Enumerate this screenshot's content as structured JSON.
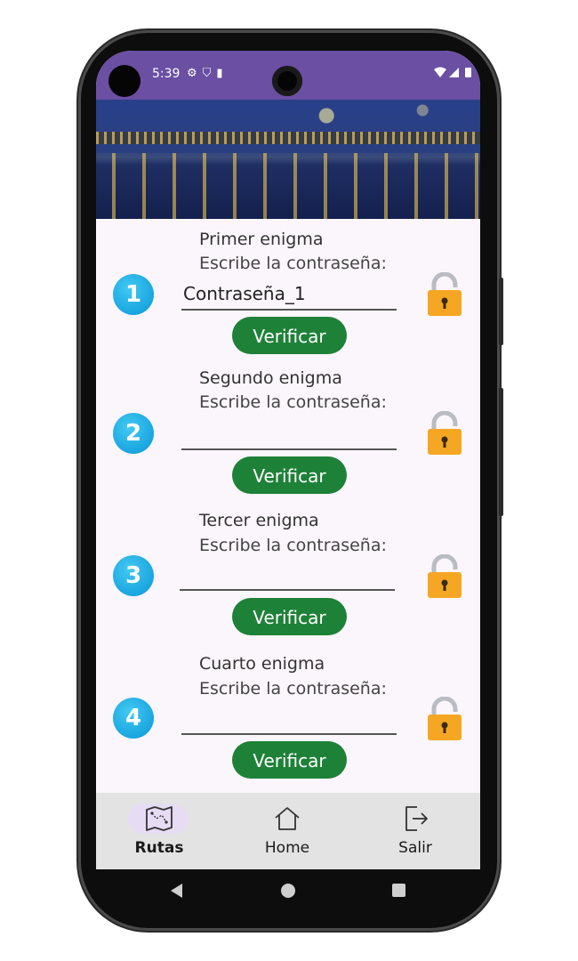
{
  "status_bar": {
    "time": "5:39",
    "left_icons": [
      "gear-icon",
      "shield-icon",
      "sim-card-icon"
    ],
    "right_icons": [
      "wifi-icon",
      "signal-icon",
      "battery-icon"
    ]
  },
  "banner": {
    "description_icon": "starry-night-image"
  },
  "enigmas": [
    {
      "number": "1",
      "title": "Primer enigma",
      "prompt": "Escribe la contraseña:",
      "value": "Contraseña_1",
      "button": "Verificar"
    },
    {
      "number": "2",
      "title": "Segundo enigma",
      "prompt": "Escribe la contraseña:",
      "value": "",
      "button": "Verificar"
    },
    {
      "number": "3",
      "title": "Tercer enigma",
      "prompt": "Escribe la contraseña:",
      "value": "",
      "button": "Verificar"
    },
    {
      "number": "4",
      "title": "Cuarto enigma",
      "prompt": "Escribe la contraseña:",
      "value": "",
      "button": "Verificar"
    }
  ],
  "bottom_nav": {
    "items": [
      {
        "label": "Rutas",
        "icon": "map-icon",
        "selected": true
      },
      {
        "label": "Home",
        "icon": "home-icon",
        "selected": false
      },
      {
        "label": "Salir",
        "icon": "logout-icon",
        "selected": false
      }
    ]
  },
  "colors": {
    "status_bar": "#6a4fa3",
    "verify_button": "#1e8138",
    "number_badge": "#1aa6e0",
    "lock": "#f5a623",
    "nav_selected": "#e6dcf4"
  }
}
